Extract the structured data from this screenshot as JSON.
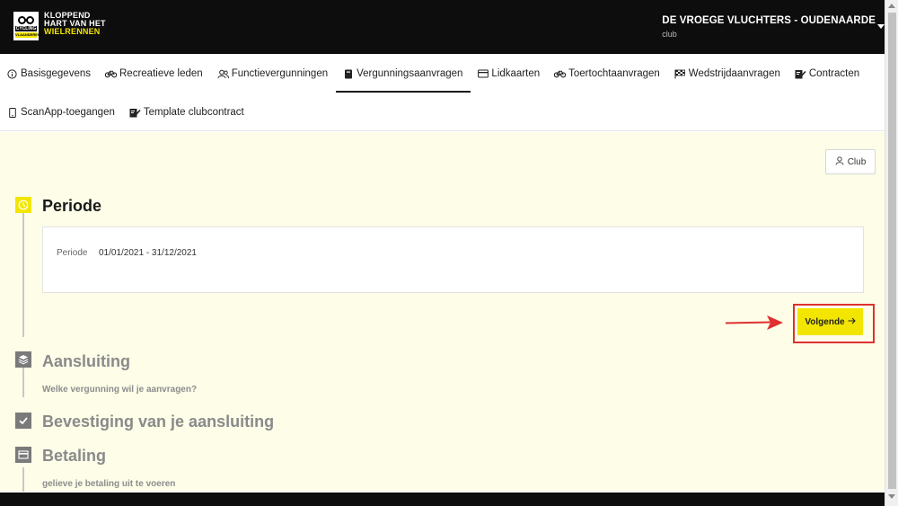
{
  "brand": {
    "logo_lines": [
      "KLOPPEND",
      "HART VAN HET",
      "WIELRENNEN"
    ],
    "badge_top": "CYCLING",
    "badge_bottom": "VLAANDEREN"
  },
  "club_selector": {
    "name": "DE VROEGE VLUCHTERS - OUDENAARDE",
    "subtitle": "club"
  },
  "nav": {
    "items": [
      {
        "label": "Basisgegevens",
        "icon": "info-circle-icon"
      },
      {
        "label": "Recreatieve leden",
        "icon": "bicycle-icon"
      },
      {
        "label": "Functievergunningen",
        "icon": "users-icon"
      },
      {
        "label": "Vergunningsaanvragen",
        "icon": "book-icon",
        "active": true
      },
      {
        "label": "Lidkaarten",
        "icon": "card-icon"
      },
      {
        "label": "Toertochtaanvragen",
        "icon": "bicycle-icon"
      },
      {
        "label": "Wedstrijdaanvragen",
        "icon": "checkered-flag-icon"
      },
      {
        "label": "Contracten",
        "icon": "signature-icon"
      },
      {
        "label": "ScanApp-toegangen",
        "icon": "mobile-icon"
      },
      {
        "label": "Template clubcontract",
        "icon": "signature-icon"
      }
    ]
  },
  "main": {
    "club_button_label": "Club",
    "steps": [
      {
        "title": "Periode",
        "icon": "clock-icon",
        "status": "active"
      },
      {
        "title": "Aansluiting",
        "icon": "layers-icon",
        "subtitle": "Welke vergunning wil je aanvragen?",
        "status": "inactive"
      },
      {
        "title": "Bevestiging van je aansluiting",
        "icon": "check-icon",
        "status": "inactive"
      },
      {
        "title": "Betaling",
        "icon": "credit-card-icon",
        "subtitle": "gelieve je betaling uit te voeren",
        "status": "inactive"
      }
    ],
    "periode_card": {
      "label": "Periode",
      "value": "01/01/2021 - 31/12/2021"
    },
    "next_button_label": "Volgende"
  },
  "colors": {
    "accent": "#f2e600",
    "topbar": "#0d0d0d",
    "main_bg": "#fdfde8",
    "annotation": "#e03030"
  }
}
